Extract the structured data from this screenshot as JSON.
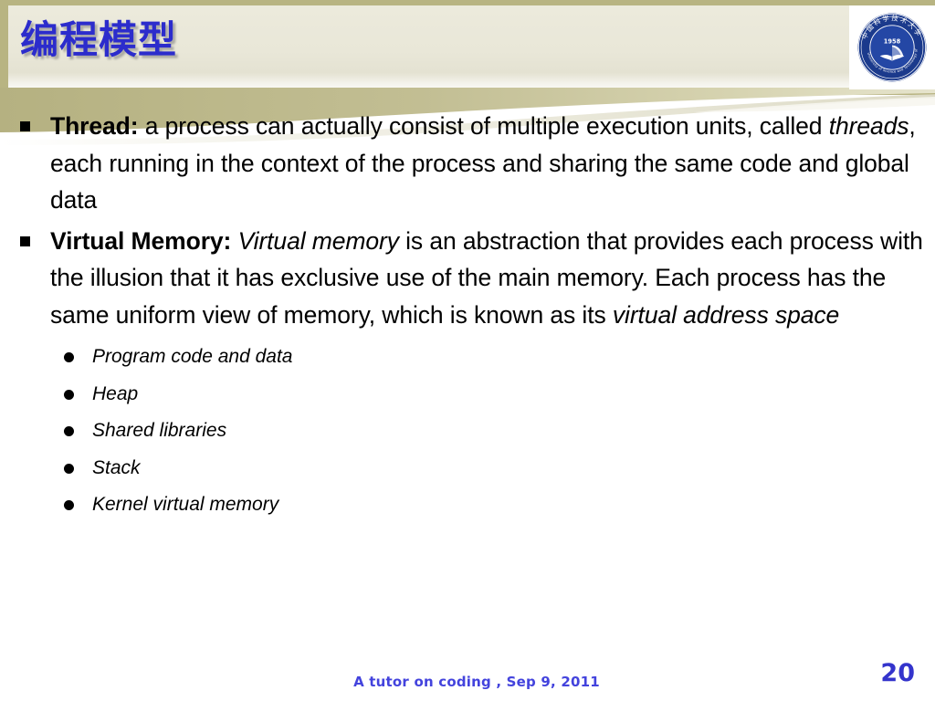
{
  "slide": {
    "title": "编程模型",
    "logo": {
      "name": "ustc-seal-logo",
      "year": "1958",
      "ring_text_cn": "中国科学技术大学",
      "ring_text_en": "University of Science and Technology of China"
    },
    "colors": {
      "title_blue": "#2c2ccc",
      "header_band": "#b8b482",
      "header_plate": "#e9e7d8",
      "swoosh_dark": "#b9b588",
      "swoosh_light": "#e4e2d1",
      "footer_blue": "#4343dd",
      "page_number_blue": "#3434cc",
      "body_text": "#000000",
      "logo_navy": "#1b3a8c"
    }
  },
  "body": {
    "bullets": [
      {
        "marker": "square-bullet",
        "segments": [
          {
            "text": "Thread:",
            "style": "bold"
          },
          {
            "text": " a process can actually consist of multiple execution units, called ",
            "style": "normal"
          },
          {
            "text": "threads",
            "style": "italic"
          },
          {
            "text": ", each running in the context of the process and sharing the same code and global data",
            "style": "normal"
          }
        ]
      },
      {
        "marker": "square-bullet",
        "segments": [
          {
            "text": "Virtual Memory:",
            "style": "bold"
          },
          {
            "text": " ",
            "style": "normal"
          },
          {
            "text": "Virtual memory",
            "style": "italic"
          },
          {
            "text": " is an abstraction that provides each process with the illusion that it has exclusive use of the main memory. Each process has the same uniform view of memory, which is known as its ",
            "style": "normal"
          },
          {
            "text": "virtual address space",
            "style": "italic"
          }
        ]
      }
    ],
    "sub_bullets": [
      {
        "marker": "round-bullet",
        "label": "Program code and data"
      },
      {
        "marker": "round-bullet",
        "label": "Heap"
      },
      {
        "marker": "round-bullet",
        "label": "Shared libraries"
      },
      {
        "marker": "round-bullet",
        "label": "Stack"
      },
      {
        "marker": "round-bullet",
        "label": "Kernel virtual memory"
      }
    ]
  },
  "footer": {
    "note": "A tutor on coding , Sep 9, 2011",
    "page_number": "20"
  }
}
